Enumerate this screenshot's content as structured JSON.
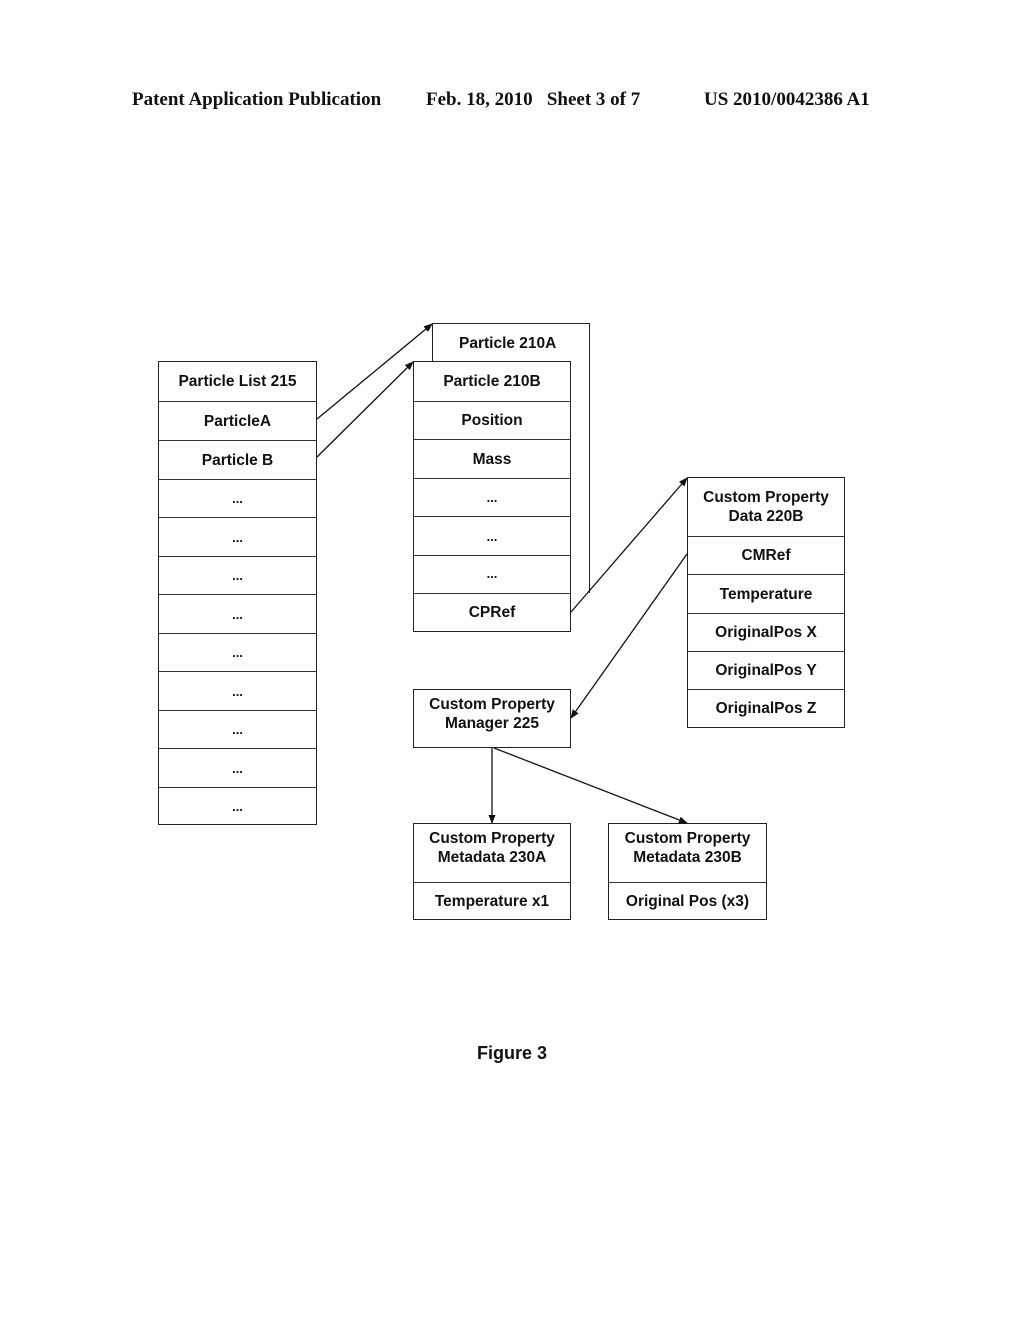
{
  "header": {
    "publication": "Patent Application Publication",
    "date_sheet": "Feb. 18, 2010   Sheet 3 of 7",
    "patent_number": "US 2010/0042386 A1"
  },
  "particle_list": {
    "title": "Particle List 215",
    "rows": [
      "ParticleA",
      "Particle B",
      "...",
      "...",
      "...",
      "...",
      "...",
      "...",
      "...",
      "...",
      "..."
    ]
  },
  "particle_a": {
    "title": "Particle 210A"
  },
  "particle_b": {
    "title": "Particle 210B",
    "rows": [
      "Position",
      "Mass",
      "...",
      "...",
      "...",
      "CPRef"
    ]
  },
  "custom_property_data": {
    "title": "Custom Property Data 220B",
    "rows": [
      "CMRef",
      "Temperature",
      "OriginalPos X",
      "OriginalPos Y",
      "OriginalPos Z"
    ]
  },
  "custom_property_manager": {
    "title": "Custom Property Manager 225"
  },
  "metadata_a": {
    "title": "Custom Property Metadata 230A",
    "rows": [
      "Temperature x1"
    ]
  },
  "metadata_b": {
    "title": "Custom Property Metadata 230B",
    "rows": [
      "Original Pos (x3)"
    ]
  },
  "caption": "Figure 3"
}
